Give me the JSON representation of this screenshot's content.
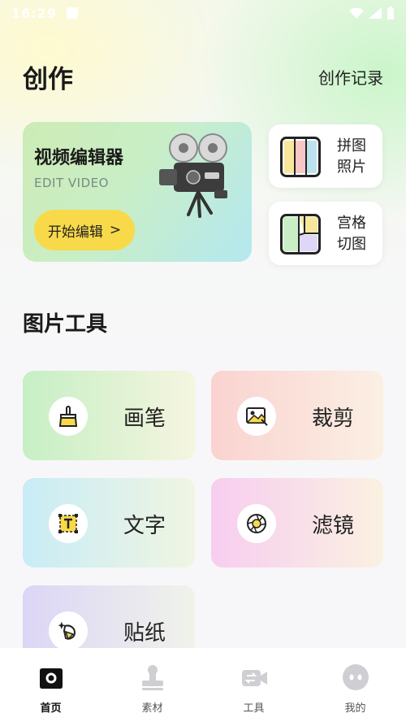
{
  "status_bar": {
    "time": "16:29"
  },
  "header": {
    "title": "创作",
    "history_link": "创作记录"
  },
  "hero": {
    "title": "视频编辑器",
    "subtitle": "EDIT VIDEO",
    "button_label": "开始编辑",
    "button_arrow": ">"
  },
  "side_cards": [
    {
      "line1": "拼图",
      "line2": "照片",
      "icon": "collage-icon"
    },
    {
      "line1": "宫格",
      "line2": "切图",
      "icon": "grid-cut-icon"
    }
  ],
  "section": {
    "title": "图片工具"
  },
  "tools": [
    {
      "label": "画笔",
      "icon": "brush-icon"
    },
    {
      "label": "裁剪",
      "icon": "crop-image-icon"
    },
    {
      "label": "文字",
      "icon": "text-icon"
    },
    {
      "label": "滤镜",
      "icon": "aperture-icon"
    },
    {
      "label": "贴纸",
      "icon": "sticker-icon"
    }
  ],
  "tab_bar": {
    "items": [
      {
        "label": "首页",
        "icon": "home-camera-icon",
        "active": true
      },
      {
        "label": "素材",
        "icon": "stamp-icon",
        "active": false
      },
      {
        "label": "工具",
        "icon": "video-tool-icon",
        "active": false
      },
      {
        "label": "我的",
        "icon": "profile-icon",
        "active": false
      }
    ]
  },
  "colors": {
    "accent_yellow": "#f8d94a",
    "background": "#f7f7f9"
  }
}
